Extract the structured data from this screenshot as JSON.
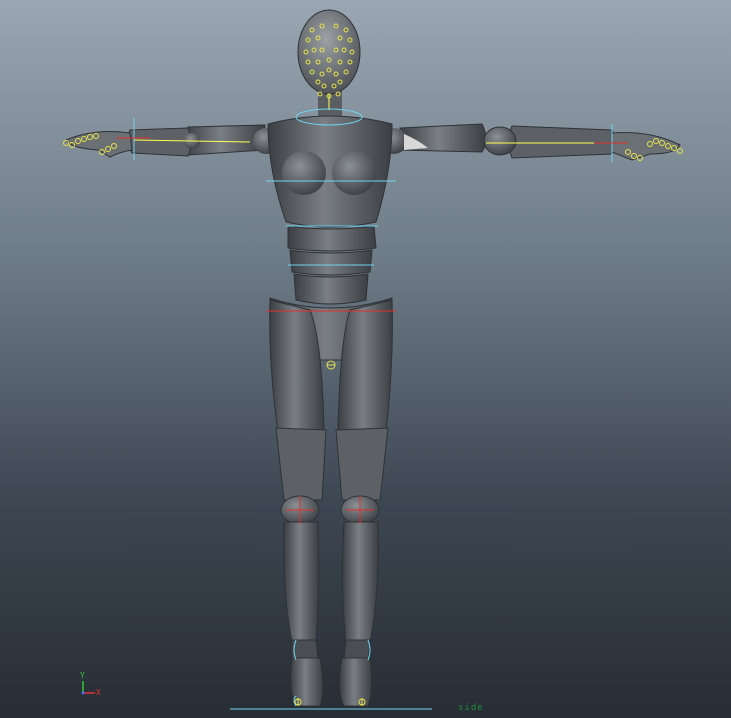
{
  "viewport": {
    "camera_label": "side",
    "axis_labels": {
      "y": "Y",
      "x": "X"
    },
    "colors": {
      "body": "#5d6166",
      "body_highlight": "#8c9196",
      "body_shadow": "#3b3e42",
      "control_curve": "#6fd3ee",
      "joint_marker": "#e23030",
      "facial_locator": "#e7e24a",
      "bone": "#ffff55",
      "axis_x": "#e23030",
      "axis_y": "#35c535",
      "axis_z": "#4a6cff"
    },
    "icons": [
      "view-axis-icon"
    ]
  }
}
